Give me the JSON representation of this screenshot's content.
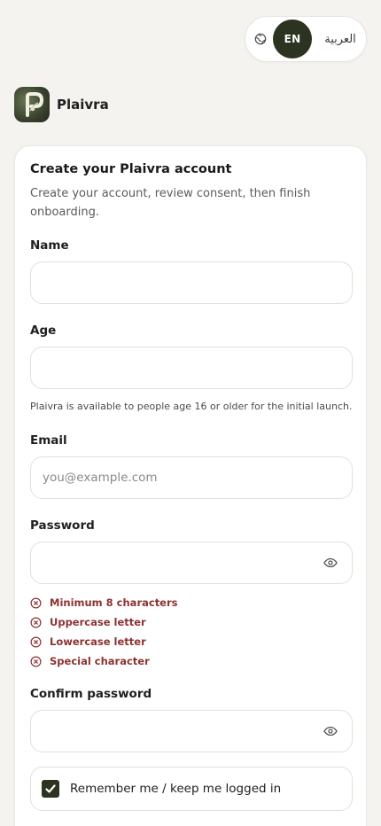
{
  "language_toggle": {
    "globe_icon": "globe-icon",
    "english": "EN",
    "arabic": "العربية"
  },
  "brand": {
    "name": "Plaivra",
    "logo_icon": "plaivra-logo"
  },
  "form": {
    "title": "Create your Plaivra account",
    "subtitle": "Create your account, review consent, then finish onboarding.",
    "name": {
      "label": "Name",
      "value": ""
    },
    "age": {
      "label": "Age",
      "value": "",
      "hint": "Plaivra is available to people age 16 or older for the initial launch."
    },
    "email": {
      "label": "Email",
      "placeholder": "you@example.com",
      "value": ""
    },
    "password": {
      "label": "Password",
      "value": "",
      "toggle_icon": "eye-icon",
      "requirements": [
        {
          "text": "Minimum 8 characters",
          "met": false
        },
        {
          "text": "Uppercase letter",
          "met": false
        },
        {
          "text": "Lowercase letter",
          "met": false
        },
        {
          "text": "Special character",
          "met": false
        }
      ]
    },
    "confirm_password": {
      "label": "Confirm password",
      "value": "",
      "toggle_icon": "eye-icon"
    },
    "remember": {
      "label": "Remember me / keep me logged in",
      "checked": true
    }
  },
  "colors": {
    "background": "#f5f3ef",
    "accent": "#2c3320",
    "error": "#8c3232"
  }
}
